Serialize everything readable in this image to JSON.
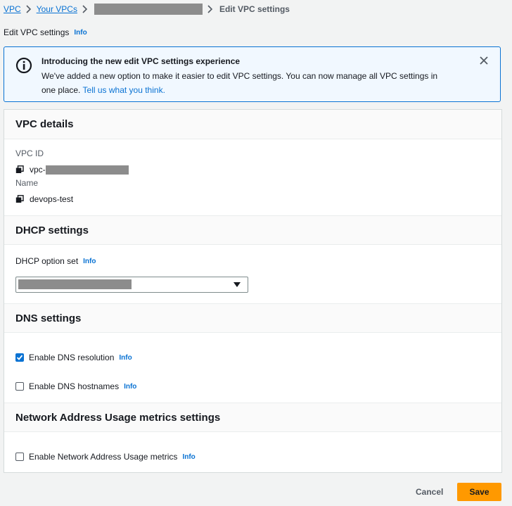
{
  "breadcrumb": {
    "vpc": "VPC",
    "your_vpcs": "Your VPCs",
    "current": "Edit VPC settings"
  },
  "page": {
    "title": "Edit VPC settings",
    "info": "Info"
  },
  "flash": {
    "title": "Introducing the new edit VPC settings experience",
    "body": "We've added a new option to make it easier to edit VPC settings. You can now manage all VPC settings in one place.",
    "link": "Tell us what you think."
  },
  "vpc_details": {
    "header": "VPC details",
    "vpc_id_label": "VPC ID",
    "vpc_id_prefix": "vpc-",
    "name_label": "Name",
    "name_value": "devops-test"
  },
  "dhcp": {
    "header": "DHCP settings",
    "option_label": "DHCP option set",
    "info": "Info"
  },
  "dns": {
    "header": "DNS settings",
    "resolution_label": "Enable DNS resolution",
    "resolution_checked": true,
    "hostnames_label": "Enable DNS hostnames",
    "hostnames_checked": false,
    "info": "Info"
  },
  "nau": {
    "header": "Network Address Usage metrics settings",
    "enable_label": "Enable Network Address Usage metrics",
    "enable_checked": false,
    "info": "Info"
  },
  "footer": {
    "cancel": "Cancel",
    "save": "Save"
  },
  "colors": {
    "accent": "#0972d3",
    "save": "#ff9900"
  }
}
